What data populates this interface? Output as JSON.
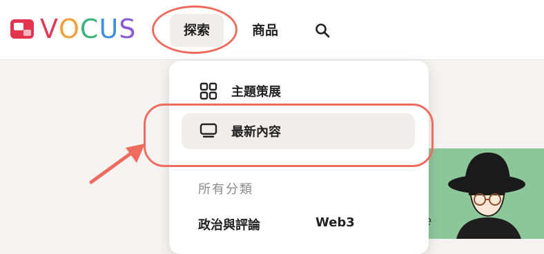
{
  "brand": {
    "logo_text": "VOCUS",
    "letters": [
      "V",
      "O",
      "C",
      "U",
      "S"
    ],
    "letter_colors": [
      "#e0395a",
      "#f2a13a",
      "#3cb37a",
      "#3f8fe0",
      "#8b5bd6"
    ],
    "mark_color": "#e4334f"
  },
  "nav": {
    "explore_label": "探索",
    "products_label": "商品",
    "search_icon": "search-icon"
  },
  "dropdown": {
    "items": [
      {
        "label": "主題策展",
        "icon": "grid-icon"
      },
      {
        "label": "最新內容",
        "icon": "monitor-icon"
      }
    ],
    "section_label": "所有分類",
    "categories": [
      "政治與評論",
      "Web3"
    ]
  },
  "annotation_color": "#ee6b5d",
  "card_partial_text": "e"
}
